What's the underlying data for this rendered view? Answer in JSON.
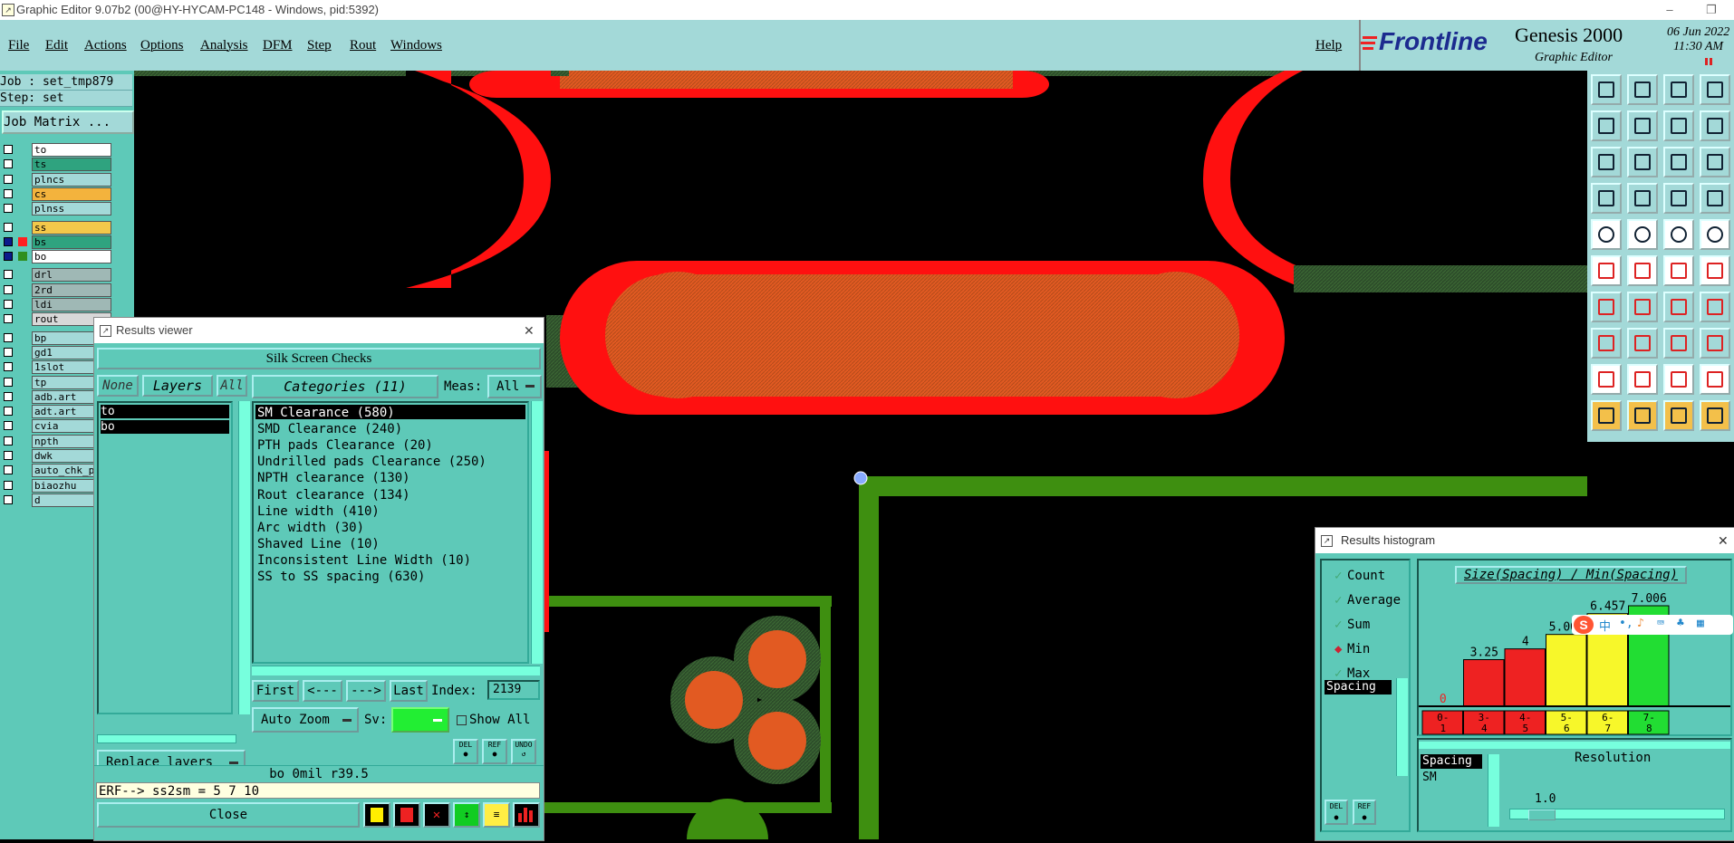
{
  "window": {
    "title": "Graphic Editor 9.07b2 (00@HY-HYCAM-PC148 - Windows, pid:5392)",
    "controls": [
      "–",
      "❐",
      "✕"
    ]
  },
  "menu": {
    "items": [
      "File",
      "Edit",
      "Actions",
      "Options",
      "Analysis",
      "DFM",
      "Step",
      "Rout",
      "Windows"
    ],
    "help": "Help"
  },
  "brand": {
    "logo": "Frontline",
    "product": "Genesis 2000",
    "subtitle": "Graphic Editor",
    "date": "06 Jun 2022",
    "time": "11:30 AM"
  },
  "job": {
    "job_line": "Job : set_tmp879",
    "step_line": "Step: set",
    "matrix_button": "Job Matrix ..."
  },
  "layers": [
    {
      "name": "to",
      "color": "#ffffff",
      "active": false
    },
    {
      "name": "ts",
      "color": "#2fa37f",
      "active": false
    },
    {
      "name": "plncs",
      "color": "#a3d9d8",
      "active": false
    },
    {
      "name": "cs",
      "color": "#f3b33d",
      "active": false
    },
    {
      "name": "plnss",
      "color": "#a3d9d8",
      "active": false
    },
    {
      "name": "ss",
      "color": "#f3c84a",
      "active": false
    },
    {
      "name": "bs",
      "color": "#2fa37f",
      "active": true,
      "swatch": "#ff2020"
    },
    {
      "name": "bo",
      "color": "#ffffff",
      "active": true,
      "swatch": "#2f8f1f"
    },
    {
      "name": "drl",
      "color": "#9fb8b5",
      "active": false
    },
    {
      "name": "2rd",
      "color": "#9fb8b5",
      "active": false
    },
    {
      "name": "ldi",
      "color": "#9fb8b5",
      "active": false
    },
    {
      "name": "rout",
      "color": "#d8d8d8",
      "active": false
    },
    {
      "name": "bp",
      "color": "#a3d9d8",
      "active": false
    },
    {
      "name": "gd1",
      "color": "#a3d9d8",
      "active": false
    },
    {
      "name": "1slot",
      "color": "#a3d9d8",
      "active": false
    },
    {
      "name": "tp",
      "color": "#a3d9d8",
      "active": false
    },
    {
      "name": "adb.art",
      "color": "#a3d9d8",
      "active": false
    },
    {
      "name": "adt.art",
      "color": "#a3d9d8",
      "active": false
    },
    {
      "name": "cvia",
      "color": "#a3d9d8",
      "active": false
    },
    {
      "name": "npth",
      "color": "#a3d9d8",
      "active": false
    },
    {
      "name": "dwk",
      "color": "#a3d9d8",
      "active": false
    },
    {
      "name": "auto_chk_p",
      "color": "#a3d9d8",
      "active": false
    },
    {
      "name": "biaozhu",
      "color": "#a3d9d8",
      "active": false
    },
    {
      "name": "d",
      "color": "#a3d9d8",
      "active": false
    }
  ],
  "results_viewer": {
    "title": "Results viewer",
    "check_name": "Silk Screen Checks",
    "none_btn": "None",
    "layers_btn": "Layers",
    "all_btn": "All",
    "layer_list": [
      "to",
      "bo"
    ],
    "categories_btn": "Categories (11)",
    "meas_label": "Meas:",
    "meas_value": "All",
    "categories": [
      "SM Clearance (580)",
      "SMD Clearance (240)",
      "PTH pads Clearance (20)",
      "Undrilled pads Clearance (250)",
      "NPTH clearance (130)",
      "Rout clearance (134)",
      "Line width (410)",
      "Arc width (30)",
      "Shaved Line (10)",
      "Inconsistent Line Width (10)",
      "SS to SS spacing (630)"
    ],
    "first_btn": "First",
    "prev_btn": "<---",
    "next_btn": "--->",
    "last_btn": "Last",
    "index_label": "Index:",
    "index_value": "2139",
    "auto_zoom": "Auto Zoom",
    "sv_label": "Sv:",
    "show_all": "Show All",
    "replace_layers": "Replace layers",
    "status": "bo  0mil  r39.5",
    "erf_line": "ERF--> ss2sm = 5 7 10",
    "close_btn": "Close"
  },
  "histogram": {
    "title": "Results histogram",
    "options": [
      {
        "label": "Count",
        "selected": false
      },
      {
        "label": "Average",
        "selected": false
      },
      {
        "label": "Sum",
        "selected": false
      },
      {
        "label": "Min",
        "selected": true
      },
      {
        "label": "Max",
        "selected": false
      }
    ],
    "measure_list": [
      "Spacing"
    ],
    "chart_title": "Size(Spacing) / Min(Spacing)",
    "bars": [
      {
        "label": "0-\n1",
        "value": 0,
        "color": "#ee2222"
      },
      {
        "label": "3-\n4",
        "value": 3.25,
        "color": "#ee2222"
      },
      {
        "label": "4-\n5",
        "value": 4,
        "color": "#ee2222"
      },
      {
        "label": "5-\n6",
        "value": 5.007,
        "color": "#f7f72a"
      },
      {
        "label": "6-\n7",
        "value": 6.457,
        "color": "#f7f72a"
      },
      {
        "label": "7-\n8",
        "value": 7.006,
        "color": "#22dd33"
      }
    ],
    "value_labels": [
      "0",
      "3.25",
      "4",
      "5.007",
      "6.457",
      "7.006"
    ],
    "bottom_list": [
      "Spacing",
      "SM"
    ],
    "resolution_label": "Resolution",
    "resolution_value": "1.0",
    "del_btn": "DEL",
    "ref_btn": "REF"
  },
  "tray": {
    "ime": "中"
  }
}
